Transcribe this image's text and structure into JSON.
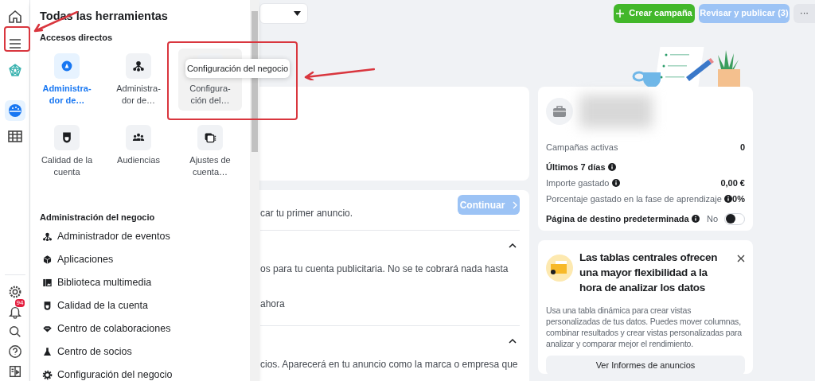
{
  "rail": {
    "items": [
      {
        "kind": "home",
        "selected": false
      },
      {
        "kind": "menu",
        "selected": false
      },
      {
        "kind": "network",
        "selected": false
      },
      {
        "kind": "gauge",
        "selected": true
      },
      {
        "kind": "table",
        "selected": false
      }
    ],
    "bottom_items": [
      {
        "kind": "settings"
      },
      {
        "kind": "bell",
        "badge": "94"
      },
      {
        "kind": "search"
      },
      {
        "kind": "help"
      },
      {
        "kind": "panel"
      }
    ]
  },
  "drawer": {
    "title": "Todas las herramientas",
    "shortcuts_heading": "Accesos directos",
    "shortcuts": [
      {
        "kind": "ads",
        "lines": [
          "Administra-",
          "dor de…"
        ],
        "selected": true,
        "hovered": false
      },
      {
        "kind": "events",
        "lines": [
          "Administra-",
          "dor de…"
        ],
        "selected": false,
        "hovered": false
      },
      {
        "lines": [
          "Configura-",
          "ción del…"
        ],
        "selected": false,
        "hovered": true
      },
      {
        "kind": "quality",
        "lines": [
          "Calidad de la",
          "cuenta"
        ],
        "selected": false,
        "hovered": false
      },
      {
        "kind": "audiences",
        "lines": [
          "Audiencias"
        ],
        "selected": false,
        "hovered": false
      },
      {
        "kind": "account",
        "lines": [
          "Ajustes de",
          "cuenta…"
        ],
        "selected": false,
        "hovered": false
      }
    ],
    "tooltip": "Configuración del negocio",
    "business_heading": "Administración del negocio",
    "business_items": [
      {
        "kind": "events",
        "label": "Administrador de eventos"
      },
      {
        "kind": "apps",
        "label": "Aplicaciones"
      },
      {
        "kind": "media",
        "label": "Biblioteca multimedia"
      },
      {
        "kind": "quality",
        "label": "Calidad de la cuenta"
      },
      {
        "kind": "collab",
        "label": "Centro de colaboraciones"
      },
      {
        "kind": "partners",
        "label": "Centro de socios"
      },
      {
        "kind": "settings",
        "label": "Configuración del negocio"
      }
    ]
  },
  "top_buttons": [
    {
      "kind": "create",
      "label": "Crear campaña",
      "disabled": false
    },
    {
      "kind": "review",
      "label": "Revisar y publicar (3)",
      "disabled": true
    },
    {
      "kind": "more",
      "label": "···",
      "disabled": false
    }
  ],
  "setup_card": {
    "intro": "car tu primer anuncio.",
    "continue_button": {
      "label": "Continuar",
      "disabled": true
    },
    "sections": [
      {
        "expanded": true,
        "lines": [
          "os para tu cuenta publicitaria. No se te cobrará nada hasta",
          "ahora"
        ]
      },
      {
        "expanded": true,
        "lines": [
          "cios. Aparecerá en tu anuncio como la marca o empresa que"
        ]
      }
    ]
  },
  "summary_card": {
    "rows": [
      {
        "kind": "stat",
        "label": "Campañas activas",
        "value": "0",
        "info": false
      },
      {
        "kind": "heading",
        "label": "Últimos 7 días",
        "info": true
      },
      {
        "kind": "stat",
        "label": "Importe gastado",
        "value": "0,00 €",
        "info": true
      },
      {
        "kind": "stat",
        "label": "Porcentaje gastado en la fase de aprendizaje",
        "value": "0%",
        "info": true
      },
      {
        "kind": "toggle",
        "label": "Página de destino predeterminada",
        "value": "No",
        "on": false,
        "info": true
      }
    ]
  },
  "tip_card": {
    "title": "Las tablas centrales ofrecen una mayor flexibilidad a la hora de analizar los datos",
    "body": "Usa una tabla dinámica para crear vistas personalizadas de tus datos. Puedes mover columnas, combinar resultados y crear vistas personalizadas para analizar y comparar mejor el rendimiento.",
    "button": "Ver Informes de anuncios"
  }
}
